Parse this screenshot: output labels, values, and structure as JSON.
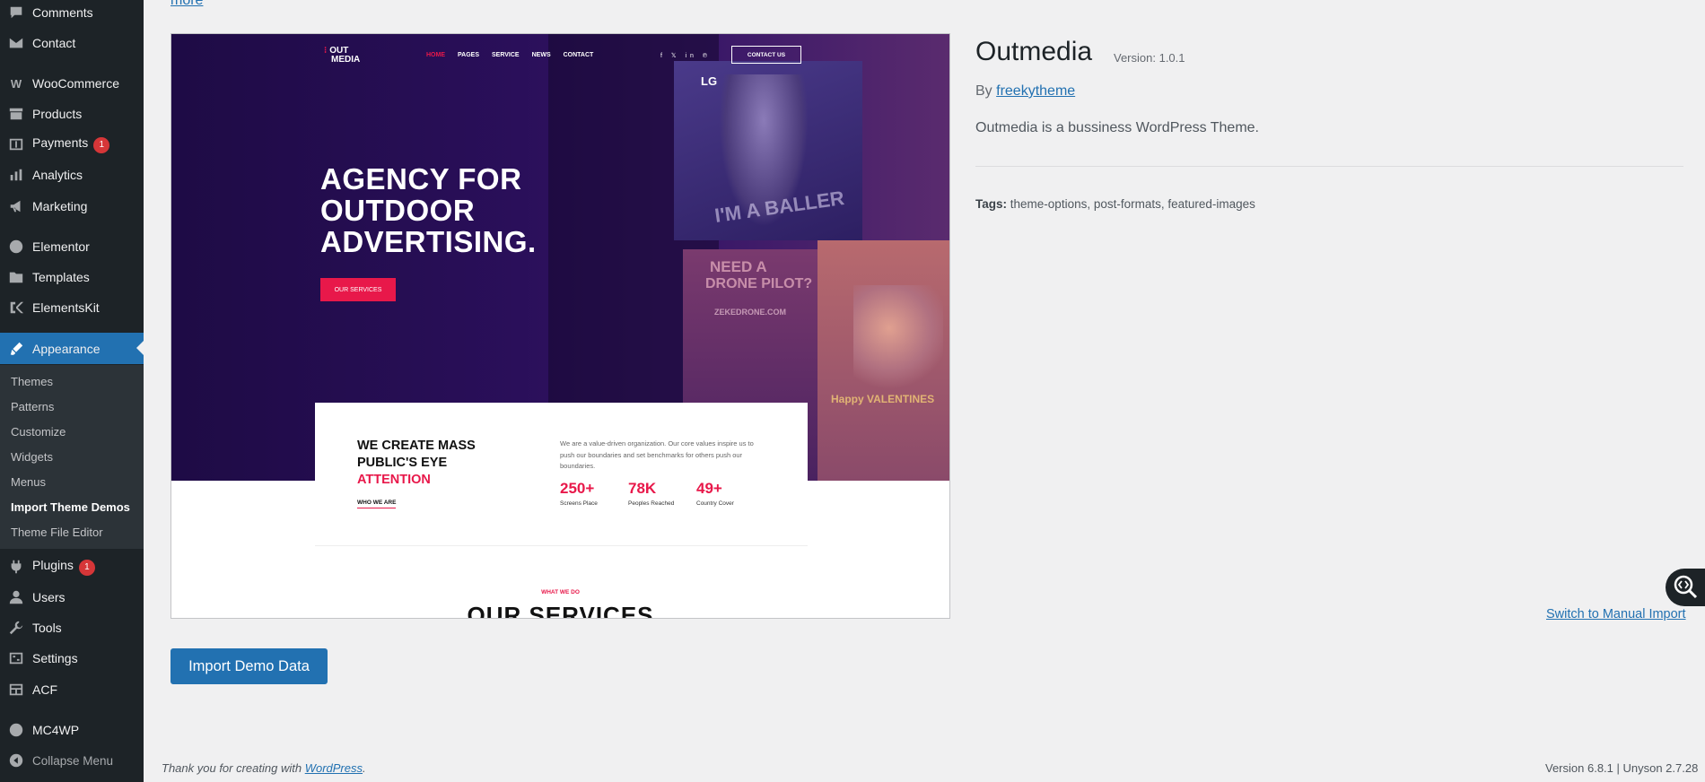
{
  "sidebar": {
    "items": [
      {
        "label": "Comments",
        "icon": "comment-icon"
      },
      {
        "label": "Contact",
        "icon": "mail-icon"
      },
      {
        "label": "WooCommerce",
        "icon": "woocommerce-icon"
      },
      {
        "label": "Products",
        "icon": "archive-icon"
      },
      {
        "label": "Payments",
        "icon": "dollar-icon",
        "badge": "1"
      },
      {
        "label": "Analytics",
        "icon": "bar-chart-icon"
      },
      {
        "label": "Marketing",
        "icon": "megaphone-icon"
      },
      {
        "label": "Elementor",
        "icon": "elementor-icon"
      },
      {
        "label": "Templates",
        "icon": "folder-icon"
      },
      {
        "label": "ElementsKit",
        "icon": "elementskit-icon"
      },
      {
        "label": "Appearance",
        "icon": "brush-icon"
      },
      {
        "label": "Plugins",
        "icon": "plug-icon",
        "badge": "1"
      },
      {
        "label": "Users",
        "icon": "user-icon"
      },
      {
        "label": "Tools",
        "icon": "wrench-icon"
      },
      {
        "label": "Settings",
        "icon": "settings-icon"
      },
      {
        "label": "ACF",
        "icon": "acf-icon"
      },
      {
        "label": "MC4WP",
        "icon": "mc4wp-icon"
      }
    ],
    "appearance_submenu": [
      "Themes",
      "Patterns",
      "Customize",
      "Widgets",
      "Menus",
      "Import Theme Demos",
      "Theme File Editor"
    ],
    "collapse_label": "Collapse Menu"
  },
  "main": {
    "more_link": "more",
    "preview": {
      "logo_line1": "OUT",
      "logo_line2": "MEDIA",
      "nav": [
        "HOME",
        "PAGES",
        "SERVICE",
        "NEWS",
        "CONTACT"
      ],
      "social": "f  𝕏  in  ℗",
      "contact_btn": "CONTACT US",
      "hero_title_1": "AGENCY FOR",
      "hero_title_2": "OUTDOOR",
      "hero_title_3": "ADVERTISING.",
      "hero_btn": "OUR SERVICES",
      "billboard_lg": "LG",
      "billboard_baller": "I'M A BALLER",
      "billboard_drone_1": "NEED A",
      "billboard_drone_2": "DRONE PILOT?",
      "billboard_drone_3": "ZEKEDRONE.COM",
      "billboard_valentine": "Happy VALENTINES",
      "card_title_1": "WE CREATE MASS",
      "card_title_2": "PUBLIC'S EYE",
      "card_title_accent": "ATTENTION",
      "card_link": "WHO WE ARE",
      "card_desc": "We are a value-driven organization. Our core values inspire us to push our boundaries and set benchmarks for others push our boundaries.",
      "stats": [
        {
          "value": "250+",
          "label": "Screens Place"
        },
        {
          "value": "78K",
          "label": "Peoples Reached"
        },
        {
          "value": "49+",
          "label": "Country Cover"
        }
      ],
      "section_eyebrow": "WHAT WE DO",
      "section_title": "OUR SERVICES"
    },
    "theme": {
      "name": "Outmedia",
      "version": "Version: 1.0.1",
      "by_prefix": "By",
      "author": "freekytheme",
      "description": "Outmedia is a bussiness WordPress Theme.",
      "tags_label": "Tags:",
      "tags": "theme-options, post-formats, featured-images"
    },
    "switch_link": "Switch to Manual Import",
    "import_button": "Import Demo Data"
  },
  "footer": {
    "thanks_prefix": "Thank you for creating with",
    "wordpress_link": "WordPress",
    "thanks_suffix": ".",
    "version": "Version 6.8.1 | Unyson 2.7.28"
  },
  "colors": {
    "admin_blue": "#2271b1",
    "sidebar_bg": "#1d2327",
    "badge_red": "#d63638",
    "outmedia_red": "#e8184a",
    "hero_purple": "#2a0f5a"
  }
}
